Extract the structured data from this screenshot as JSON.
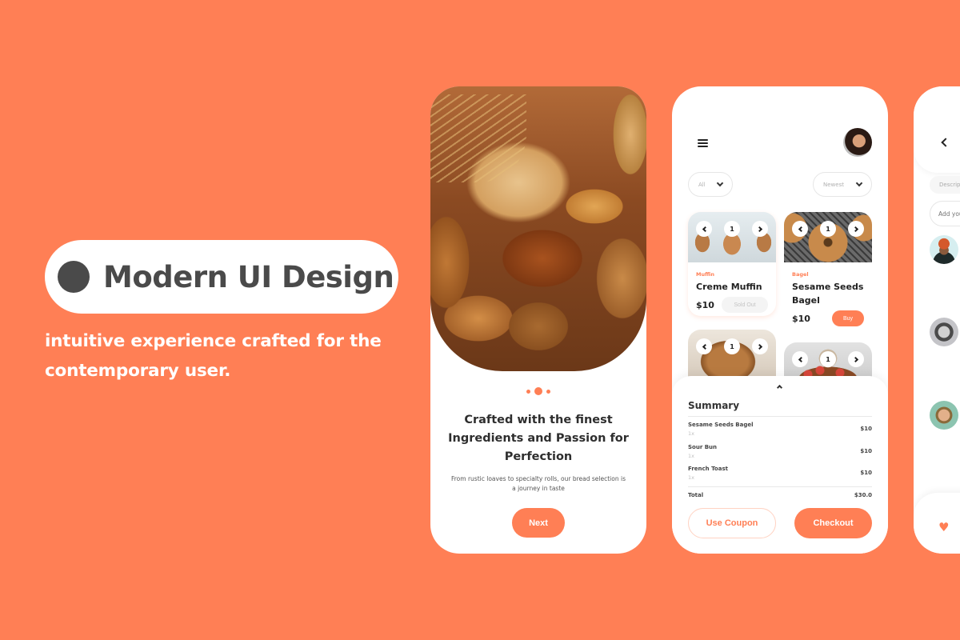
{
  "hero": {
    "title": "Modern UI Design",
    "subtitle": "intuitive experience crafted for the contemporary user."
  },
  "colors": {
    "accent": "#FF7F55",
    "background": "#FF7F55",
    "text_dark": "#4a4a4a"
  },
  "onboarding": {
    "image": "bread-basket-image",
    "pagination": {
      "current": 2,
      "total": 3
    },
    "title": "Crafted with the finest Ingredients and Passion for Perfection",
    "description": "From rustic loaves to specialty rolls, our bread selection is a journey in taste",
    "next_label": "Next"
  },
  "shop": {
    "menu_icon": "hamburger-icon",
    "filter_category": "All",
    "filter_sort": "Newest",
    "products": [
      {
        "category": "Muffin",
        "name": "Creme Muffin",
        "price": "$10",
        "image_index": "1",
        "action": "Sold Out"
      },
      {
        "category": "Bagel",
        "name": "Sesame Seeds Bagel",
        "price": "$10",
        "image_index": "1",
        "action": "Buy"
      },
      {
        "image_index": "1"
      },
      {
        "image_index": "1"
      }
    ],
    "summary": {
      "title": "Summary",
      "items": [
        {
          "name": "Sesame Seeds Bagel",
          "qty": "1x",
          "price": "$10"
        },
        {
          "name": "Sour Bun",
          "qty": "1x",
          "price": "$10"
        },
        {
          "name": "French Toast",
          "qty": "1x",
          "price": "$10"
        }
      ],
      "total_label": "Total",
      "total_value": "$30.0",
      "coupon_label": "Use Coupon",
      "checkout_label": "Checkout"
    }
  },
  "detail": {
    "description_chip": "Description",
    "comment_placeholder": "Add your comment"
  }
}
